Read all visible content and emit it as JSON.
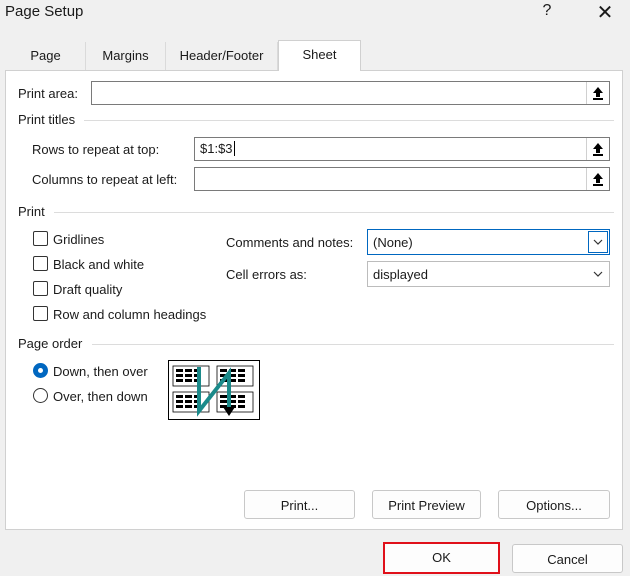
{
  "window": {
    "title": "Page Setup",
    "help_glyph": "?",
    "close_glyph": "✕"
  },
  "tabs": [
    {
      "label": "Page"
    },
    {
      "label": "Margins"
    },
    {
      "label": "Header/Footer"
    },
    {
      "label": "Sheet"
    }
  ],
  "print_area": {
    "label": "Print area:",
    "value": ""
  },
  "print_titles": {
    "heading": "Print titles",
    "rows_label": "Rows to repeat at top:",
    "rows_value": "$1:$3",
    "cols_label": "Columns to repeat at left:",
    "cols_value": ""
  },
  "print": {
    "heading": "Print",
    "gridlines": "Gridlines",
    "black_white": "Black and white",
    "draft": "Draft quality",
    "headings": "Row and column headings",
    "comments_label": "Comments and notes:",
    "comments_value": "(None)",
    "errors_label": "Cell errors as:",
    "errors_value": "displayed"
  },
  "page_order": {
    "heading": "Page order",
    "down_over": "Down, then over",
    "over_down": "Over, then down",
    "selected": "down_over"
  },
  "buttons": {
    "print": "Print...",
    "preview": "Print Preview",
    "options": "Options...",
    "ok": "OK",
    "cancel": "Cancel"
  },
  "colors": {
    "accent": "#0067c0",
    "highlight_box": "#e0101a",
    "arrow": "#1a8a8a"
  }
}
